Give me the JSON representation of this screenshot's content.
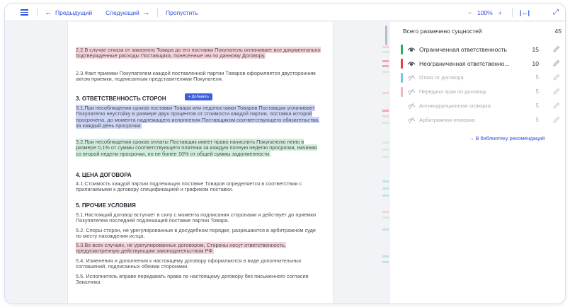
{
  "toolbar": {
    "prev_label": "Предыдущий",
    "next_label": "Следующий",
    "skip_label": "Пропустить",
    "zoom_minus": "−",
    "zoom_value": "100%",
    "zoom_plus": "+",
    "icons": {
      "menu": "hamburger-icon",
      "prev": "arrow-left-icon",
      "next": "arrow-right-icon",
      "fit": "fit-width-icon",
      "expand": "expand-icon"
    }
  },
  "document": {
    "p22": "2.2.В случае отказа от заказного Товара до его поставки Покупатель оплачивает все документально подтвержденные расходы Поставщика, понесенные им по данному Договору.",
    "p23": "2.3.Факт приемки Покупателем каждой поставленной партии Товаров оформляется двусторонним актом приемки, подписанным представителями Покупателя.",
    "h3": "3. ОТВЕТСТВЕННОСТЬ СТОРОН",
    "add_button": "+ Добавить",
    "p31": "3.1.При несоблюдении сроков поставки Товара или недопоставки Товаров Поставщик уплачивает Покупателю неустойку в размере двух процентов от стоимости каждой партии, поставка которой просрочена, до момента надлежащего исполнения Поставщиком соответствующего обязательства, за каждый день просрочки.",
    "p32": "3.2.При несоблюдении сроков оплаты Поставщик имеет право начислить Покупателю пеню в размере 0,1% от суммы соответствующего платежа за каждую полную неделю просрочки, начиная со второй недели просрочки, но не более 10% от общей суммы задолженности.",
    "h4": "4. ЦЕНА ДОГОВОРА",
    "p41": "4.1.Стоимость каждой партии подлежащих поставке Товаров определяется в соответствии с прилагаемыми к договору спецификацией и графиком поставки.",
    "h5": "5. ПРОЧИЕ УСЛОВИЯ",
    "p51": "5.1.Настоящий договор вступает в силу с момента подписания сторонами и действует до приемки Покупателем последней подлежащей поставке партии Товара.",
    "p52": "5.2. Споры сторон, не урегулированные в досудебном порядке, разрешаются в арбитражном суде по месту нахождения истца.",
    "p53": "5.3.Во всех случаях, не урегулированных договором, Стороны несут ответственность, предусмотренную действующим законодательством РФ.",
    "p54": "5.4. Изменения и дополнения к настоящему договору оформляются в виде дополнительных соглашений, подписанных обеими сторонами.",
    "p55": "5.5. Исполнитель вправе передавать права по настоящему договору без письменного согласия Заказчика"
  },
  "panel": {
    "total_label": "Всего размечено сущностей",
    "total_count": "45",
    "entities": [
      {
        "label": "Ограниченная ответственность",
        "count": "15",
        "color": "#2fae5e",
        "visible": true,
        "eye_icon": "eye-icon",
        "edit_icon": "pencil-icon"
      },
      {
        "label": "Неограниченная ответственно...",
        "count": "10",
        "color": "#e0435a",
        "visible": true,
        "eye_icon": "eye-icon",
        "edit_icon": "pencil-icon"
      },
      {
        "label": "Отказ от договора",
        "count": "5",
        "color": "#7fc3e8",
        "visible": false,
        "eye_icon": "eye-off-icon",
        "edit_icon": "pencil-icon"
      },
      {
        "label": "Передача прав по договору",
        "count": "5",
        "color": "#f3b6c2",
        "visible": false,
        "eye_icon": "eye-off-icon",
        "edit_icon": "pencil-icon"
      },
      {
        "label": "Антикоррупционная оговорка",
        "count": "5",
        "color": "#b9bcc6",
        "visible": false,
        "eye_icon": "eye-off-icon",
        "edit_icon": "pencil-icon"
      },
      {
        "label": "Арбитражная оговорка",
        "count": "5",
        "color": "#b9bcc6",
        "visible": false,
        "eye_icon": "eye-off-icon",
        "edit_icon": "pencil-icon"
      }
    ],
    "library_link": "В библиотеку рекомендаций",
    "library_icon": "arrow-right-icon"
  },
  "colors": {
    "accent": "#3552d6",
    "highlight_red": "#f6d3d8",
    "highlight_blue": "#cdd6f5",
    "highlight_green": "#d3eddc"
  }
}
